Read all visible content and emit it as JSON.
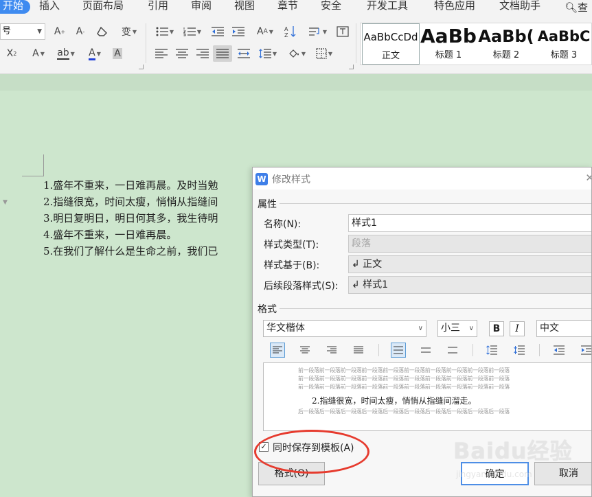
{
  "ribbon": {
    "tabs": [
      "开始",
      "插入",
      "页面布局",
      "引用",
      "审阅",
      "视图",
      "章节",
      "安全",
      "开发工具",
      "特色应用",
      "文档助手"
    ],
    "search_label": "查",
    "font_size_value": "号",
    "styles": [
      {
        "sample": "AaBbCcDd",
        "name": "正文"
      },
      {
        "sample": "AaBb",
        "name": "标题 1"
      },
      {
        "sample": "AaBb(",
        "name": "标题 2"
      },
      {
        "sample": "AaBbC",
        "name": "标题 3"
      }
    ]
  },
  "document": {
    "lines": [
      "1.盛年不重来，一日难再晨。及时当勉",
      "2.指缝很宽，时间太瘦，悄悄从指缝间",
      "3.明日复明日，明日何其多，我生待明",
      "4.盛年不重来，一日难再晨。",
      "5.在我们了解什么是生命之前，我们已"
    ]
  },
  "dialog": {
    "title": "修改样式",
    "app_icon": "W",
    "group_properties": "属性",
    "name_label": "名称(N):",
    "name_value": "样式1",
    "type_label": "样式类型(T):",
    "type_value": "段落",
    "based_on_label": "样式基于(B):",
    "based_on_value": "↲ 正文",
    "next_label": "后续段落样式(S):",
    "next_value": "↲ 样式1",
    "group_format": "格式",
    "font_value": "华文楷体",
    "size_value": "小三",
    "bold_label": "B",
    "italic_label": "I",
    "lang_value": "中文",
    "preview": {
      "prev_lines": [
        "前一段落前一段落前一段落前一段落前一段落前一段落前一段落前一段落前一段落前一段落",
        "前一段落前一段落前一段落前一段落前一段落前一段落前一段落前一段落前一段落前一段落",
        "前一段落前一段落前一段落前一段落前一段落前一段落前一段落前一段落前一段落前一段落"
      ],
      "sample_text": "2.指缝很宽，时间太瘦，悄悄从指缝间溜走。",
      "next_line": "后一段落后一段落后一段落后一段落后一段落后一段落后一段落后一段落后一段落后一段落"
    },
    "save_to_template_label": "同时保存到模板(A)",
    "save_to_template_checked": true,
    "format_button": "格式(O)",
    "ok_button": "确定",
    "cancel_button": "取消"
  },
  "watermark": {
    "text": "Baidu经验",
    "sub": "jingyan.baidu.com"
  },
  "colors": {
    "accent": "#3f8bf0",
    "page_bg": "#cde6cd",
    "annotation": "#e63b2e"
  }
}
